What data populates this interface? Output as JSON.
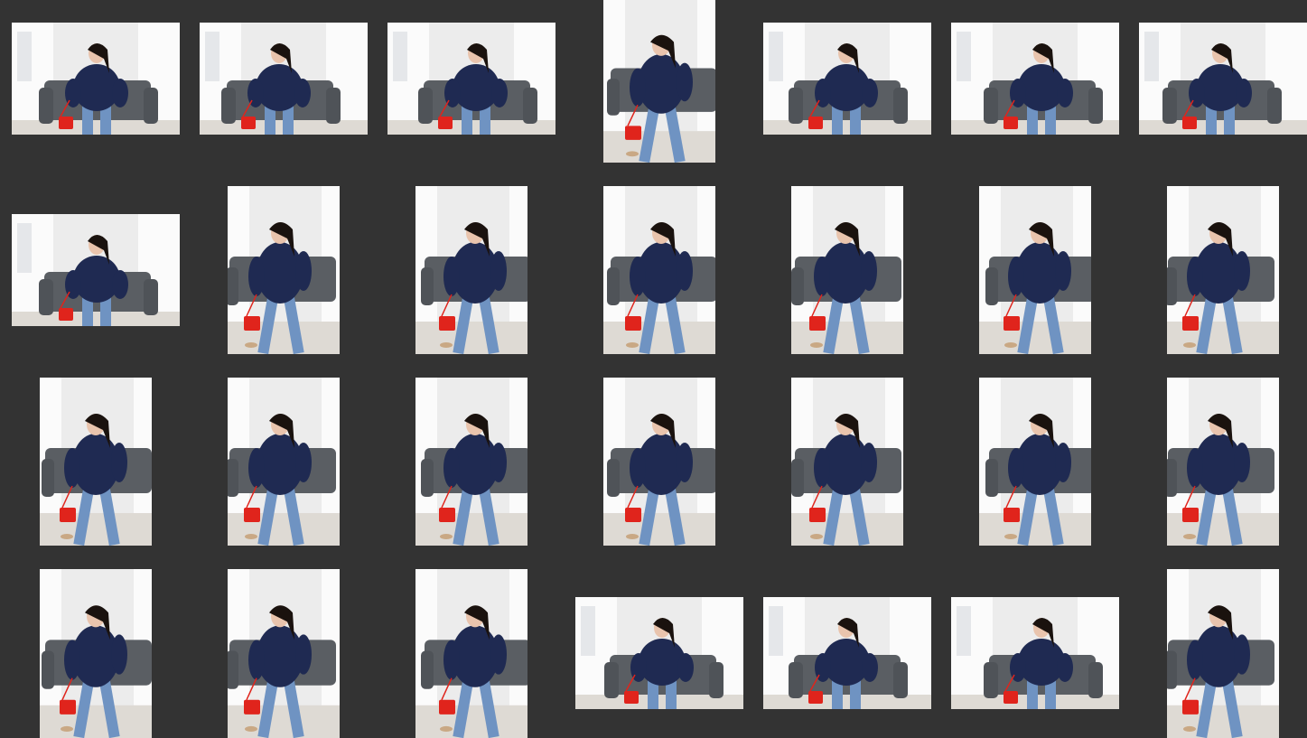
{
  "contact_sheet": {
    "background_color": "#333333",
    "thumbnail_count": 28,
    "rows": [
      [
        "landscape",
        "landscape",
        "landscape",
        "portrait",
        "landscape",
        "landscape",
        "landscape"
      ],
      [
        "landscape",
        "portrait",
        "portrait",
        "portrait",
        "portrait",
        "portrait",
        "portrait"
      ],
      [
        "portrait",
        "portrait",
        "portrait",
        "portrait",
        "portrait",
        "portrait",
        "portrait"
      ],
      [
        "portrait",
        "portrait",
        "portrait",
        "landscape",
        "landscape",
        "landscape",
        "portrait"
      ]
    ],
    "photo_subject": {
      "sweater_color": "#1f2a52",
      "jeans_color": "#6f93c2",
      "bag_color": "#e0241c",
      "sofa_color": "#5a5e63",
      "wall_color": "#ececec",
      "window_color": "#fbfbfb",
      "floor_color": "#dedad4"
    }
  }
}
